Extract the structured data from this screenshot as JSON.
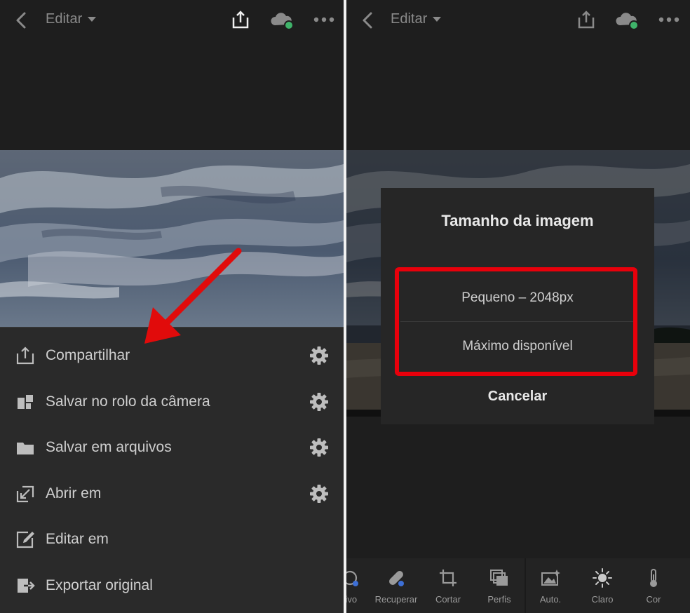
{
  "left": {
    "topbar": {
      "title": "Editar"
    },
    "menu": [
      {
        "label": "Compartilhar",
        "icon": "share-icon",
        "gear": true
      },
      {
        "label": "Salvar no rolo da câmera",
        "icon": "camera-roll-icon",
        "gear": true
      },
      {
        "label": "Salvar em arquivos",
        "icon": "folder-icon",
        "gear": true
      },
      {
        "label": "Abrir em",
        "icon": "open-in-icon",
        "gear": true
      },
      {
        "label": "Editar em",
        "icon": "edit-in-icon",
        "gear": false
      },
      {
        "label": "Exportar original",
        "icon": "export-icon",
        "gear": false
      }
    ]
  },
  "right": {
    "topbar": {
      "title": "Editar"
    },
    "dialog": {
      "title": "Tamanho da imagem",
      "option_small": "Pequeno – 2048px",
      "option_max": "Máximo disponível",
      "cancel": "Cancelar"
    },
    "toolbar": [
      {
        "label": "tivo",
        "icon": "selective-icon"
      },
      {
        "label": "Recuperar",
        "icon": "heal-icon"
      },
      {
        "label": "Cortar",
        "icon": "crop-icon"
      },
      {
        "label": "Perfis",
        "icon": "profiles-icon"
      },
      {
        "label": "Auto.",
        "icon": "auto-icon"
      },
      {
        "label": "Claro",
        "icon": "light-icon"
      },
      {
        "label": "Cor",
        "icon": "color-icon"
      }
    ]
  },
  "colors": {
    "background": "#1e1e1e",
    "sheet": "#2a2a2a",
    "highlight": "#e8000b",
    "sync_dot": "#3fb36a"
  }
}
